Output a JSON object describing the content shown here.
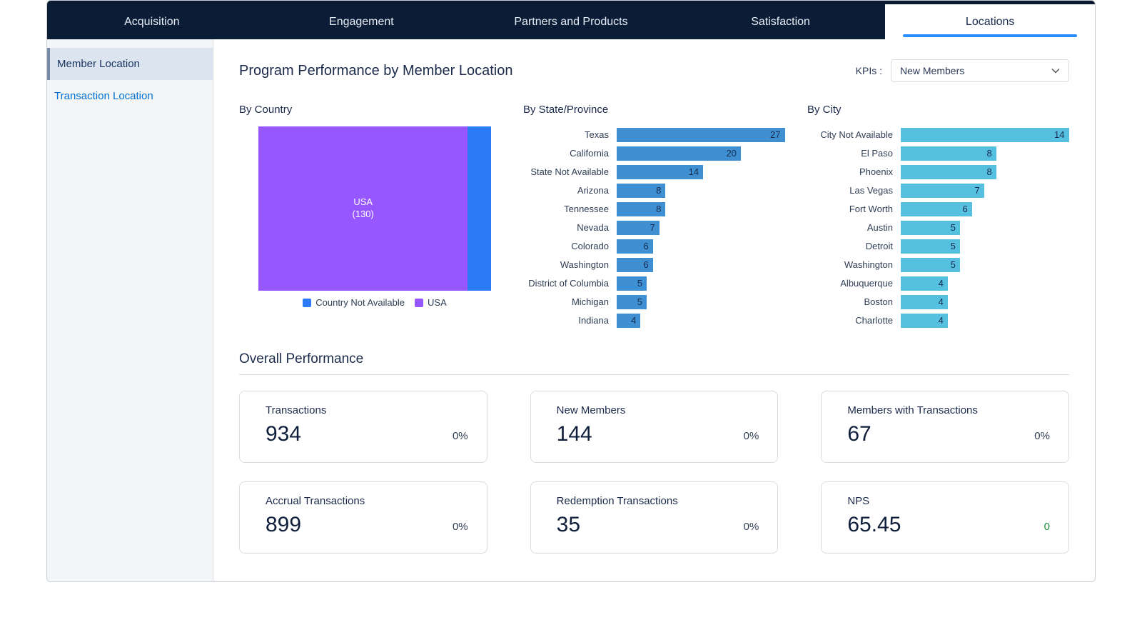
{
  "tabs": [
    "Acquisition",
    "Engagement",
    "Partners and Products",
    "Satisfaction",
    "Locations"
  ],
  "active_tab": 4,
  "sidebar": {
    "items": [
      "Member Location",
      "Transaction Location"
    ],
    "selected": 0
  },
  "header": {
    "title": "Program Performance by Member Location",
    "kpi_label": "KPIs :",
    "kpi_value": "New Members"
  },
  "chart_data": [
    {
      "type": "treemap",
      "title": "By Country",
      "primary": {
        "label": "USA",
        "sublabel": "(130)",
        "value": 130,
        "color": "#9657ff"
      },
      "secondary": {
        "label": "Country Not Available",
        "value": 14,
        "color": "#2e7bfa"
      },
      "legend": [
        {
          "color": "#2e7bfa",
          "label": "Country Not Available"
        },
        {
          "color": "#9657ff",
          "label": "USA"
        }
      ]
    },
    {
      "type": "bar",
      "title": "By State/Province",
      "color": "#3f90d3",
      "max": 27,
      "categories": [
        "Texas",
        "California",
        "State Not Available",
        "Arizona",
        "Tennessee",
        "Nevada",
        "Colorado",
        "Washington",
        "District of Columbia",
        "Michigan",
        "Indiana"
      ],
      "values": [
        27,
        20,
        14,
        8,
        8,
        7,
        6,
        6,
        5,
        5,
        4
      ]
    },
    {
      "type": "bar",
      "title": "By City",
      "color": "#56c0e0",
      "max": 14,
      "categories": [
        "City Not Available",
        "El Paso",
        "Phoenix",
        "Las Vegas",
        "Fort Worth",
        "Austin",
        "Detroit",
        "Washington",
        "Albuquerque",
        "Boston",
        "Charlotte"
      ],
      "values": [
        14,
        8,
        8,
        7,
        6,
        5,
        5,
        5,
        4,
        4,
        4
      ]
    }
  ],
  "overall": {
    "title": "Overall Performance",
    "cards": [
      {
        "label": "Transactions",
        "value": "934",
        "delta": "0%",
        "delta_style": ""
      },
      {
        "label": "New Members",
        "value": "144",
        "delta": "0%",
        "delta_style": ""
      },
      {
        "label": "Members with Transactions",
        "value": "67",
        "delta": "0%",
        "delta_style": ""
      },
      {
        "label": "Accrual Transactions",
        "value": "899",
        "delta": "0%",
        "delta_style": ""
      },
      {
        "label": "Redemption Transactions",
        "value": "35",
        "delta": "0%",
        "delta_style": ""
      },
      {
        "label": "NPS",
        "value": "65.45",
        "delta": "0",
        "delta_style": "pos"
      }
    ]
  }
}
